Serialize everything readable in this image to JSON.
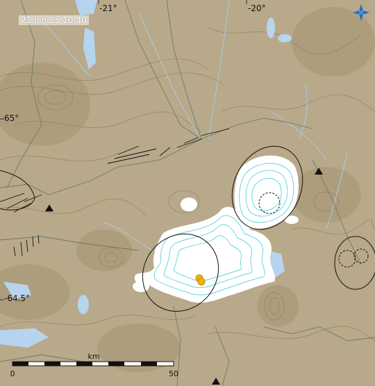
{
  "timestamp": "21.jan.25  10:40",
  "longitude_labels": [
    "-21°",
    "-20°"
  ],
  "latitude_labels": [
    "65°",
    "-64.5°"
  ],
  "scale": {
    "unit": "km",
    "start": "0",
    "end": "50"
  },
  "icons": {
    "logo": "compass-star-icon",
    "station": "triangle-station-icon",
    "quake": "earthquake-dot-icon"
  },
  "colors": {
    "terrain": "#b8a98a",
    "glacier": "#ffffff",
    "contour": "#8a7a5a",
    "glacier_contour": "#2ec8d8",
    "water": "#b6d4ee",
    "road": "#6b7a6b",
    "quake": "#f2b400",
    "logo": "#2a6fc0"
  },
  "quakes": [
    {
      "magnitude_class": "small",
      "color": "#f2b400"
    },
    {
      "magnitude_class": "small",
      "color": "#f2b400"
    }
  ]
}
